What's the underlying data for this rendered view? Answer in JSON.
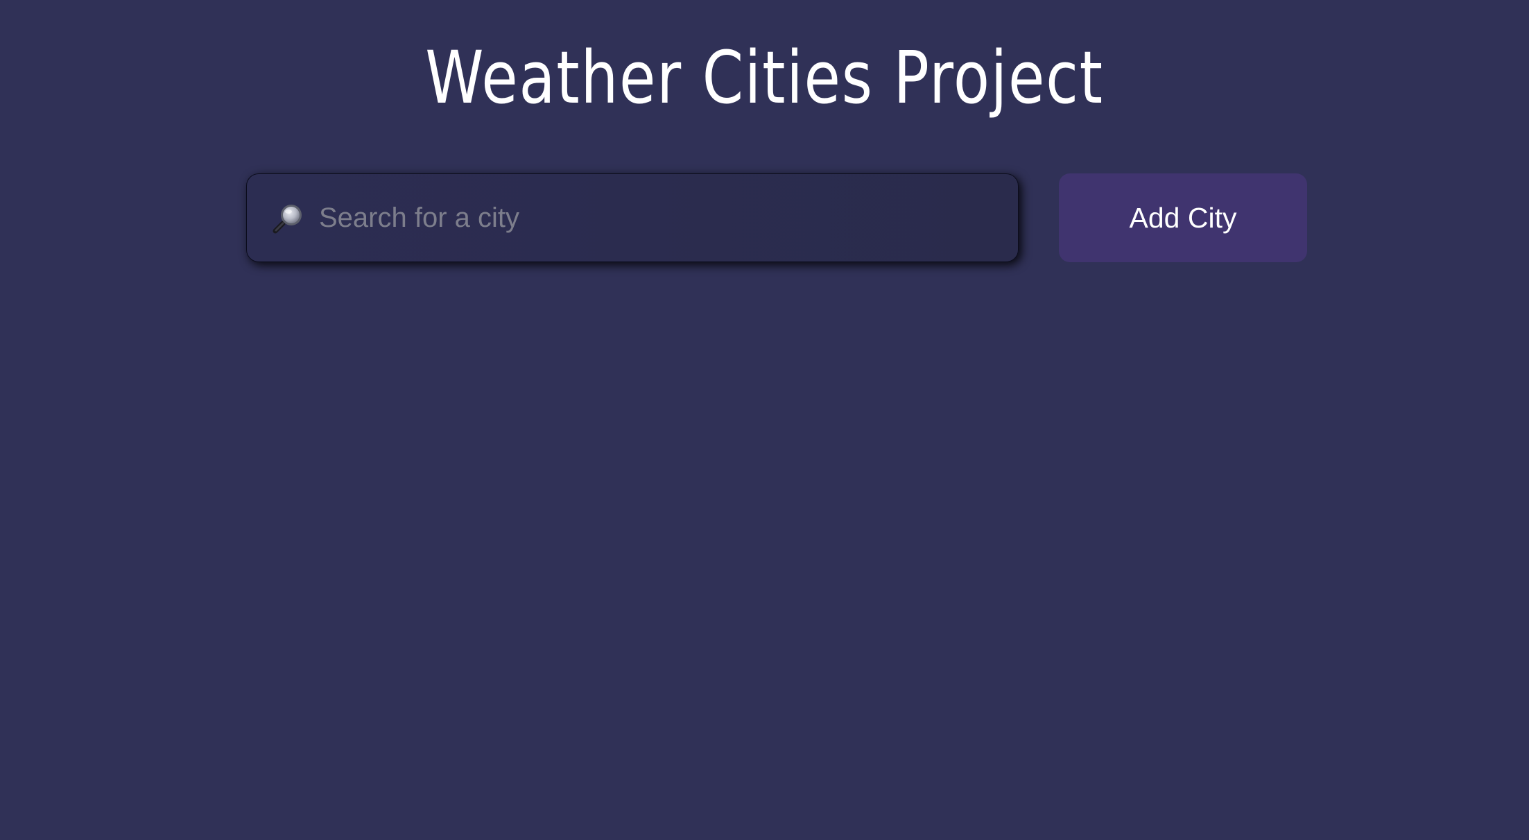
{
  "header": {
    "title": "Weather Cities Project"
  },
  "search": {
    "icon": "magnifying-glass-icon",
    "placeholder": "Search for a city",
    "value": ""
  },
  "actions": {
    "add_city_label": "Add City"
  },
  "colors": {
    "background": "#303157",
    "search_box": "#2c2d52",
    "button": "#40346f",
    "text": "#ffffff",
    "placeholder": "#7d7e8c"
  }
}
